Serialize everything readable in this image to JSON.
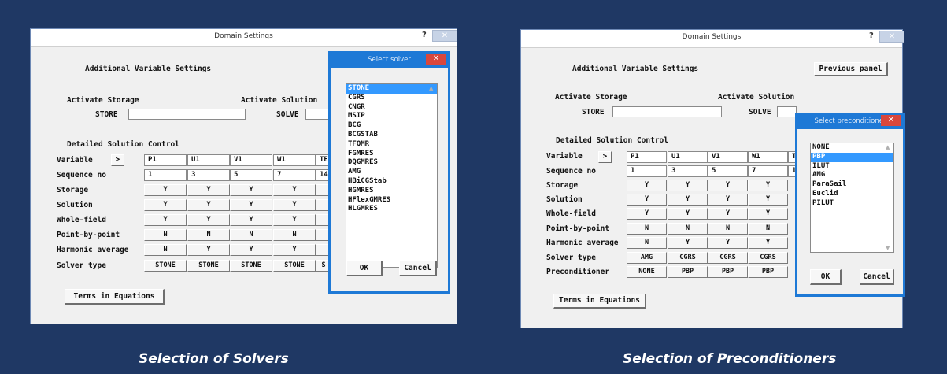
{
  "left": {
    "title": "Domain Settings",
    "help": "?",
    "close": "✕",
    "heading": "Additional Variable Settings",
    "activate_storage": "Activate Storage",
    "activate_solution": "Activate Solution",
    "store": "STORE",
    "solve": "SOLVE",
    "detailed": "Detailed Solution Control",
    "row_labels": [
      "Variable",
      "Sequence no",
      "Storage",
      "Solution",
      "Whole-field",
      "Point-by-point",
      "Harmonic average",
      "Solver type"
    ],
    "arrow": ">",
    "variables": [
      "P1",
      "U1",
      "V1",
      "W1",
      "TE"
    ],
    "sequence": [
      "1",
      "3",
      "5",
      "7",
      "14"
    ],
    "storage": [
      "Y",
      "Y",
      "Y",
      "Y",
      ""
    ],
    "solution": [
      "Y",
      "Y",
      "Y",
      "Y",
      ""
    ],
    "whole_field": [
      "Y",
      "Y",
      "Y",
      "Y",
      ""
    ],
    "point_by_point": [
      "N",
      "N",
      "N",
      "N",
      ""
    ],
    "harmonic": [
      "N",
      "Y",
      "Y",
      "Y",
      ""
    ],
    "solver_type": [
      "STONE",
      "STONE",
      "STONE",
      "STONE",
      "S"
    ],
    "terms_button": "Terms in Equations"
  },
  "solver_popup": {
    "title": "Select solver",
    "close": "✕",
    "items": [
      "STONE",
      "CGRS",
      "CNGR",
      "MSIP",
      "BCG",
      "BCGSTAB",
      "TFQMR",
      "FGMRES",
      "DQGMRES",
      "AMG",
      "HBiCGStab",
      "HGMRES",
      "HFlexGMRES",
      "HLGMRES"
    ],
    "selected": 0,
    "ok": "OK",
    "cancel": "Cancel"
  },
  "right": {
    "title": "Domain Settings",
    "help": "?",
    "close": "✕",
    "heading": "Additional Variable Settings",
    "previous_panel": "Previous panel",
    "activate_storage": "Activate Storage",
    "activate_solution": "Activate Solution",
    "store": "STORE",
    "solve": "SOLVE",
    "detailed": "Detailed Solution Control",
    "row_labels": [
      "Variable",
      "Sequence no",
      "Storage",
      "Solution",
      "Whole-field",
      "Point-by-point",
      "Harmonic average",
      "Solver type",
      "Preconditioner"
    ],
    "arrow": ">",
    "variables": [
      "P1",
      "U1",
      "V1",
      "W1",
      "T"
    ],
    "sequence": [
      "1",
      "3",
      "5",
      "7",
      "1"
    ],
    "storage": [
      "Y",
      "Y",
      "Y",
      "Y"
    ],
    "solution": [
      "Y",
      "Y",
      "Y",
      "Y"
    ],
    "whole_field": [
      "Y",
      "Y",
      "Y",
      "Y"
    ],
    "point_by_point": [
      "N",
      "N",
      "N",
      "N"
    ],
    "harmonic": [
      "N",
      "Y",
      "Y",
      "Y"
    ],
    "solver_type": [
      "AMG",
      "CGRS",
      "CGRS",
      "CGRS"
    ],
    "preconditioner": [
      "NONE",
      "PBP",
      "PBP",
      "PBP"
    ],
    "terms_button": "Terms in Equations"
  },
  "precond_popup": {
    "title": "Select preconditioner",
    "close": "✕",
    "items": [
      "NONE",
      "PBP",
      "ILUT",
      "AMG",
      "ParaSail",
      "Euclid",
      "PILUT"
    ],
    "selected": 1,
    "ok": "OK",
    "cancel": "Cancel"
  },
  "captions": {
    "left": "Selection of Solvers",
    "right": "Selection of Preconditioners"
  }
}
